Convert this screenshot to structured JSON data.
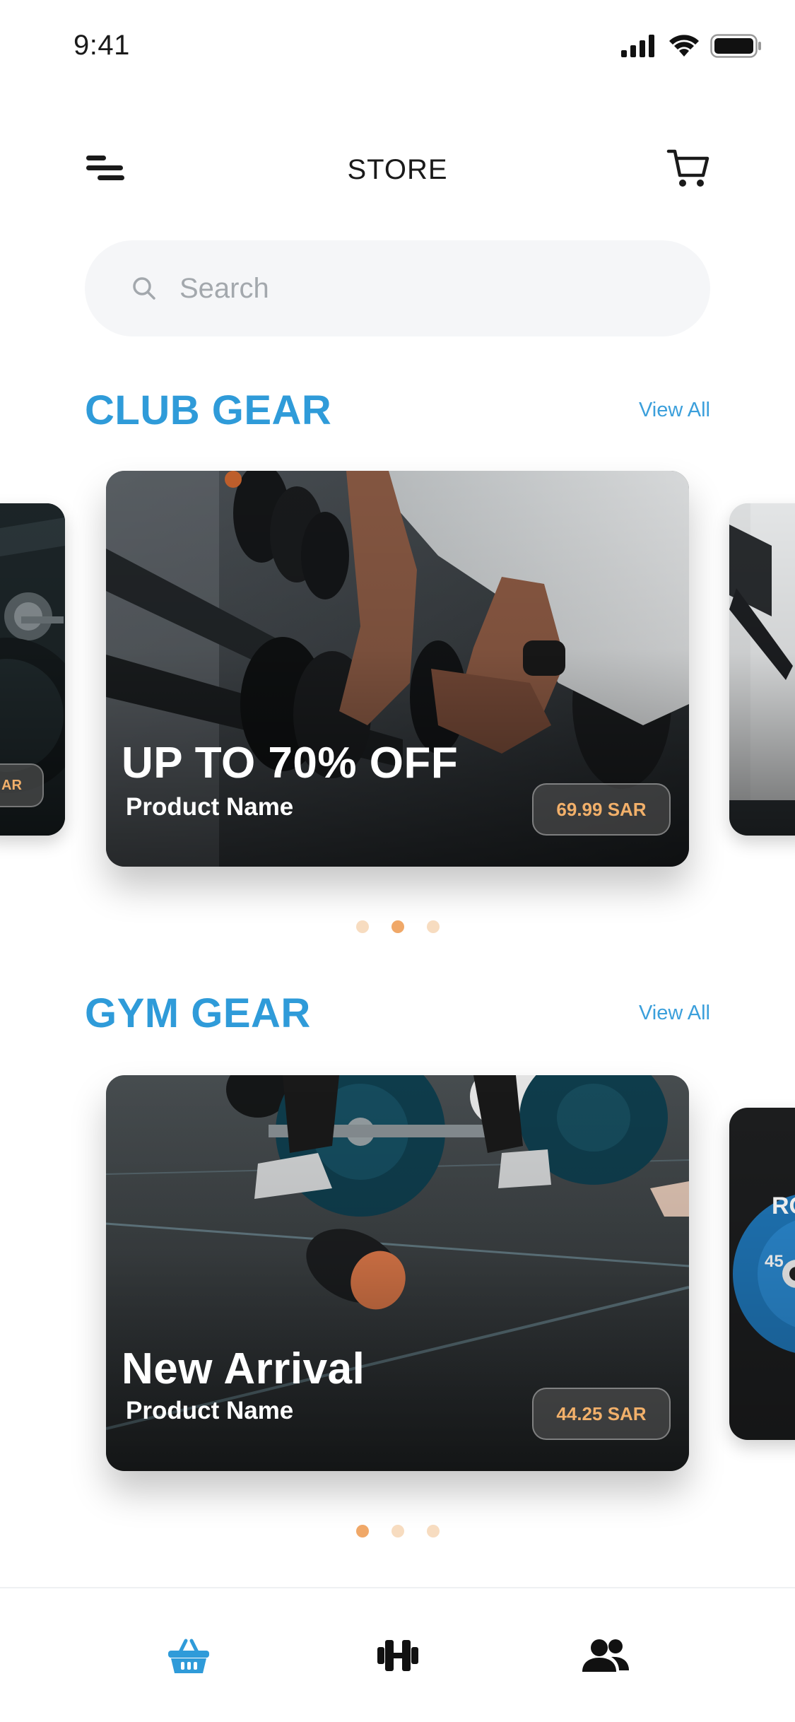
{
  "status_bar": {
    "time": "9:41",
    "icons": [
      "cellular-signal-icon",
      "wifi-icon",
      "battery-icon"
    ]
  },
  "header": {
    "title": "STORE",
    "menu_icon": "menu-icon",
    "cart_icon": "cart-icon"
  },
  "search": {
    "placeholder": "Search",
    "icon": "search-icon"
  },
  "sections": [
    {
      "title": "CLUB GEAR",
      "view_all_label": "View All",
      "card": {
        "headline": "UP TO 70% OFF",
        "product_name": "Product Name",
        "price": "69.99 SAR"
      },
      "left_peek_price": "AR",
      "carousel_active_dot": 2,
      "carousel_dot_count": 3
    },
    {
      "title": "GYM GEAR",
      "view_all_label": "View All",
      "card": {
        "headline": "New Arrival",
        "product_name": "Product Name",
        "price": "44.25 SAR"
      },
      "carousel_active_dot": 1,
      "carousel_dot_count": 3
    }
  ],
  "bottom_nav": {
    "items": [
      {
        "icon": "basket-icon",
        "active": true
      },
      {
        "icon": "dumbbell-icon",
        "active": false
      },
      {
        "icon": "users-icon",
        "active": false
      }
    ]
  },
  "colors": {
    "accent_blue": "#2f9bd9",
    "price_orange": "#f2b06a",
    "dot_active": "#f0a868",
    "dot_inactive": "#f7dcc0",
    "search_bg": "#f5f6f8"
  }
}
